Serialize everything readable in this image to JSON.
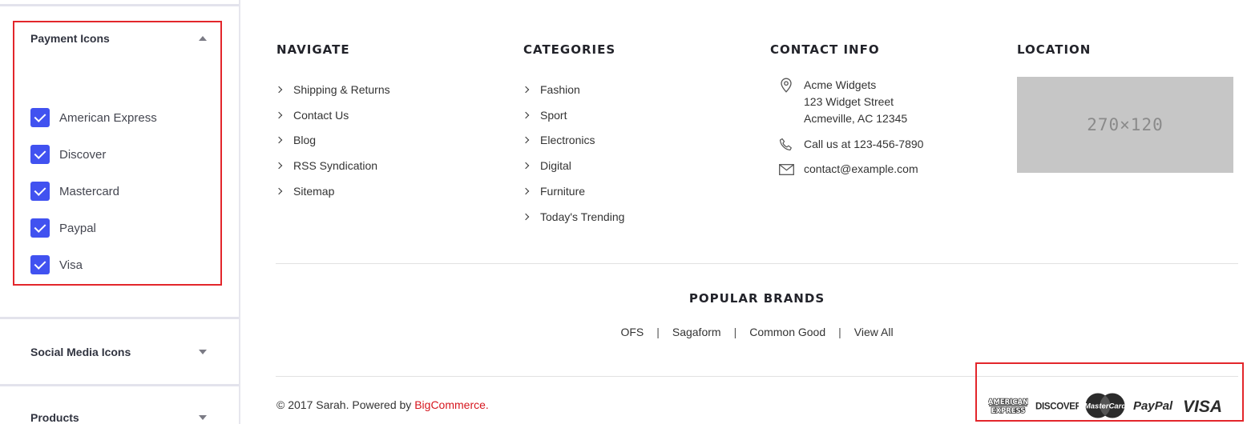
{
  "sidebar": {
    "payment_section": {
      "title": "Payment Icons",
      "expanded": true
    },
    "payment_options": [
      {
        "label": "American Express",
        "checked": true
      },
      {
        "label": "Discover",
        "checked": true
      },
      {
        "label": "Mastercard",
        "checked": true
      },
      {
        "label": "Paypal",
        "checked": true
      },
      {
        "label": "Visa",
        "checked": true
      }
    ],
    "social_section": {
      "title": "Social Media Icons",
      "expanded": false
    },
    "products_section": {
      "title": "Products",
      "expanded": false
    },
    "checkbox_color": "#4152f0"
  },
  "footer": {
    "navigate": {
      "title": "NAVIGATE",
      "links": [
        "Shipping & Returns",
        "Contact Us",
        "Blog",
        "RSS Syndication",
        "Sitemap"
      ]
    },
    "categories": {
      "title": "CATEGORIES",
      "links": [
        "Fashion",
        "Sport",
        "Electronics",
        "Digital",
        "Furniture",
        "Today's Trending"
      ]
    },
    "contact": {
      "title": "CONTACT INFO",
      "address_line1": "Acme Widgets",
      "address_line2": "123 Widget Street",
      "address_line3": "Acmeville, AC 12345",
      "phone": "Call us at 123-456-7890",
      "email": "contact@example.com"
    },
    "location": {
      "title": "LOCATION",
      "map_placeholder": "270×120"
    },
    "popular_brands": {
      "title": "POPULAR BRANDS",
      "brands": [
        "OFS",
        "Sagaform",
        "Common Good",
        "View All"
      ]
    },
    "copyright": {
      "prefix": "© 2017 Sarah. Powered by ",
      "link": "BigCommerce",
      "suffix": "."
    },
    "payment_icons": [
      "american-express-icon",
      "discover-icon",
      "mastercard-icon",
      "paypal-icon",
      "visa-icon"
    ],
    "payment_icon_text": {
      "amex_line1": "AMERICAN",
      "amex_line2": "EXPRESS",
      "discover": "DISCOVER",
      "mastercard": "MasterCard",
      "paypal": "PayPal",
      "visa": "VISA"
    },
    "accent_color": "#d6161e",
    "highlight_color": "#e3262b"
  }
}
